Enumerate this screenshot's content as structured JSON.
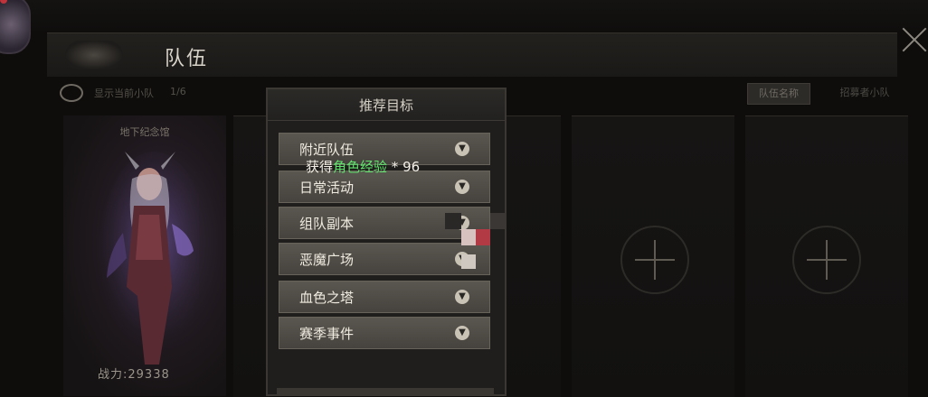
{
  "header": {
    "title": "队伍"
  },
  "subbar": {
    "label": "显示当前小队",
    "count": "1/6",
    "team_name_button": "队伍名称",
    "recruit_button": "招募者小队"
  },
  "member": {
    "name": "地下纪念馆",
    "power": "战力:29338"
  },
  "dialog": {
    "title": "推荐目标",
    "items": [
      {
        "label": "附近队伍",
        "icon": "chevron-down-icon"
      },
      {
        "label": "日常活动",
        "icon": "chevron-down-icon"
      },
      {
        "label": "组队副本",
        "icon": "chevron-down-icon"
      },
      {
        "label": "恶魔广场",
        "icon": "chevron-down-icon"
      },
      {
        "label": "血色之塔",
        "icon": "chevron-down-icon"
      },
      {
        "label": "赛季事件",
        "icon": "chevron-down-icon"
      }
    ]
  },
  "reward": {
    "prefix": "获得",
    "highlight": "角色经验",
    "suffix": " * 96"
  },
  "colors": {
    "reward_highlight": "#5fe36c",
    "item_bg": "#504c46",
    "panel_bg": "#1f1e1c"
  }
}
